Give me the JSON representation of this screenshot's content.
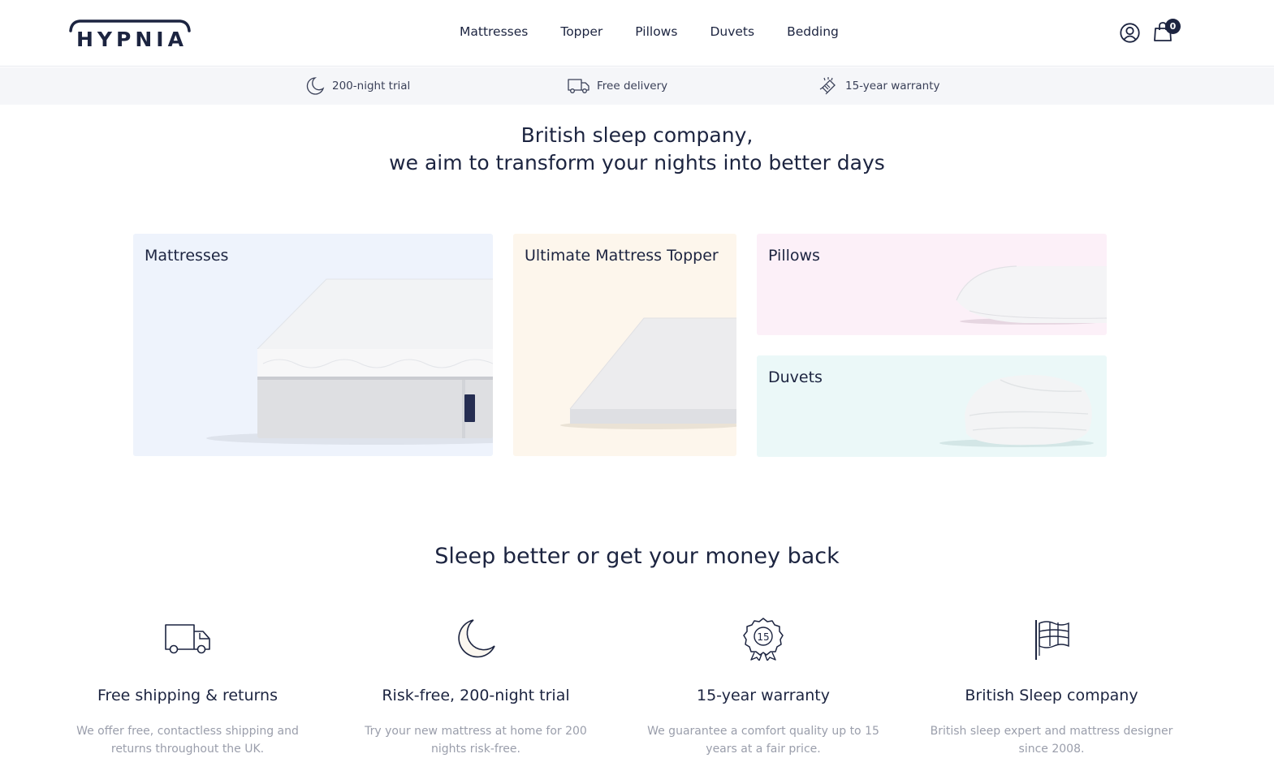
{
  "brand": {
    "logo_text": "HYPNIA"
  },
  "nav": {
    "items": [
      {
        "label": "Mattresses"
      },
      {
        "label": "Topper"
      },
      {
        "label": "Pillows"
      },
      {
        "label": "Duvets"
      },
      {
        "label": "Bedding"
      }
    ]
  },
  "header": {
    "cart_count": "0",
    "icons": [
      "account-icon",
      "shopping-bag-icon"
    ]
  },
  "usp_bar": {
    "items": [
      {
        "label": "200-night trial",
        "icon": "moon-icon"
      },
      {
        "label": "Free delivery",
        "icon": "truck-icon"
      },
      {
        "label": "15-year warranty",
        "icon": "warranty-icon"
      }
    ]
  },
  "hero": {
    "line1": "British sleep company,",
    "line2": "we aim to transform your nights into better days"
  },
  "categories": [
    {
      "label": "Mattresses",
      "bg": "#eef3fc"
    },
    {
      "label": "Ultimate Mattress Topper",
      "bg": "#fdf6ec"
    },
    {
      "label": "Pillows",
      "bg": "#fcf0f8"
    },
    {
      "label": "Duvets",
      "bg": "#ebf8f8"
    }
  ],
  "promise": {
    "title": "Sleep better or get your money back",
    "features": [
      {
        "icon": "truck-icon",
        "title": "Free shipping & returns",
        "desc": "We offer free, contactless shipping and returns throughout the UK."
      },
      {
        "icon": "moon-icon",
        "title": "Risk-free, 200-night trial",
        "desc": "Try your new mattress at home for 200 nights risk-free."
      },
      {
        "icon": "award-15-icon",
        "title": "15-year warranty",
        "desc": "We guarantee a comfort quality up to 15 years at a fair price."
      },
      {
        "icon": "union-flag-icon",
        "title": "British Sleep company",
        "desc": "British sleep expert and mattress designer since 2008."
      }
    ]
  },
  "colors": {
    "navy": "#1c2440",
    "usp_bg": "#f5f6f9",
    "muted_text": "#9a9eab"
  }
}
